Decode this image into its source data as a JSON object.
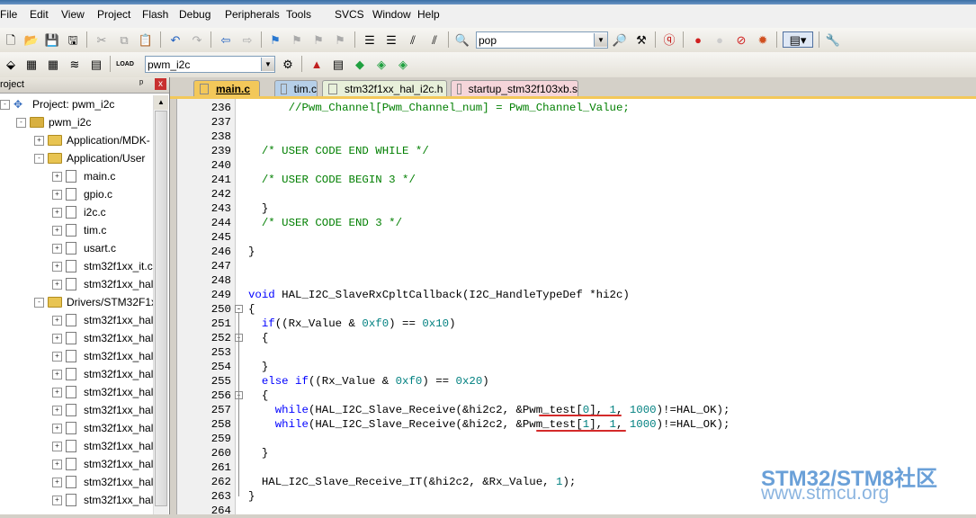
{
  "menu": [
    "File",
    "Edit",
    "View",
    "Project",
    "Flash",
    "Debug",
    "Peripherals",
    "Tools",
    "SVCS",
    "Window",
    "Help"
  ],
  "toolbar1": {
    "find_combo_value": "pop"
  },
  "toolbar2": {
    "target_combo_value": "pwm_i2c"
  },
  "project_pane": {
    "title": "roject",
    "pin": "ᵖ",
    "close": "x",
    "tree": [
      {
        "label": "Project: pwm_i2c",
        "level": 0,
        "type": "project",
        "expand": "-"
      },
      {
        "label": "pwm_i2c",
        "level": 1,
        "type": "target",
        "expand": "-"
      },
      {
        "label": "Application/MDK-",
        "level": 2,
        "type": "folder",
        "expand": "+"
      },
      {
        "label": "Application/User",
        "level": 2,
        "type": "folder",
        "expand": "-"
      },
      {
        "label": "main.c",
        "level": 3,
        "type": "file",
        "expand": "+"
      },
      {
        "label": "gpio.c",
        "level": 3,
        "type": "file",
        "expand": "+"
      },
      {
        "label": "i2c.c",
        "level": 3,
        "type": "file",
        "expand": "+"
      },
      {
        "label": "tim.c",
        "level": 3,
        "type": "file",
        "expand": "+"
      },
      {
        "label": "usart.c",
        "level": 3,
        "type": "file",
        "expand": "+"
      },
      {
        "label": "stm32f1xx_it.c",
        "level": 3,
        "type": "file",
        "expand": "+"
      },
      {
        "label": "stm32f1xx_hal",
        "level": 3,
        "type": "file",
        "expand": "+"
      },
      {
        "label": "Drivers/STM32F1x",
        "level": 2,
        "type": "folder",
        "expand": "-"
      },
      {
        "label": "stm32f1xx_hal_",
        "level": 3,
        "type": "file",
        "expand": "+"
      },
      {
        "label": "stm32f1xx_hal_",
        "level": 3,
        "type": "file",
        "expand": "+"
      },
      {
        "label": "stm32f1xx_hal_",
        "level": 3,
        "type": "file",
        "expand": "+"
      },
      {
        "label": "stm32f1xx_hal_",
        "level": 3,
        "type": "file",
        "expand": "+"
      },
      {
        "label": "stm32f1xx_hal_",
        "level": 3,
        "type": "file",
        "expand": "+"
      },
      {
        "label": "stm32f1xx_hal_",
        "level": 3,
        "type": "file",
        "expand": "+"
      },
      {
        "label": "stm32f1xx_hal_",
        "level": 3,
        "type": "file",
        "expand": "+"
      },
      {
        "label": "stm32f1xx_hal_",
        "level": 3,
        "type": "file",
        "expand": "+"
      },
      {
        "label": "stm32f1xx_hal_",
        "level": 3,
        "type": "file",
        "expand": "+"
      },
      {
        "label": "stm32f1xx_hal_",
        "level": 3,
        "type": "file",
        "expand": "+"
      },
      {
        "label": "stm32f1xx_hal_",
        "level": 3,
        "type": "file",
        "expand": "+"
      }
    ]
  },
  "tabs": [
    {
      "label": "main.c",
      "style": "active"
    },
    {
      "label": "tim.c",
      "style": "tim"
    },
    {
      "label": "stm32f1xx_hal_i2c.h",
      "style": "h"
    },
    {
      "label": "startup_stm32f103xb.s",
      "style": "s"
    }
  ],
  "code_lines": [
    {
      "n": "236",
      "fold": "",
      "segs": [
        [
          "cmt",
          "      //Pwm_Channel[Pwm_Channel_num] = Pwm_Channel_Value;"
        ]
      ]
    },
    {
      "n": "237",
      "fold": "",
      "segs": []
    },
    {
      "n": "238",
      "fold": "",
      "segs": []
    },
    {
      "n": "239",
      "fold": "",
      "segs": [
        [
          "txt",
          "  "
        ],
        [
          "cmt",
          "/* USER CODE END WHILE */"
        ]
      ]
    },
    {
      "n": "240",
      "fold": "",
      "segs": []
    },
    {
      "n": "241",
      "fold": "",
      "segs": [
        [
          "txt",
          "  "
        ],
        [
          "cmt",
          "/* USER CODE BEGIN 3 */"
        ]
      ]
    },
    {
      "n": "242",
      "fold": "",
      "segs": []
    },
    {
      "n": "243",
      "fold": "",
      "segs": [
        [
          "txt",
          "  }"
        ]
      ]
    },
    {
      "n": "244",
      "fold": "",
      "segs": [
        [
          "txt",
          "  "
        ],
        [
          "cmt",
          "/* USER CODE END 3 */"
        ]
      ]
    },
    {
      "n": "245",
      "fold": "",
      "segs": []
    },
    {
      "n": "246",
      "fold": "",
      "segs": [
        [
          "txt",
          "}"
        ]
      ]
    },
    {
      "n": "247",
      "fold": "",
      "segs": []
    },
    {
      "n": "248",
      "fold": "",
      "segs": []
    },
    {
      "n": "249",
      "fold": "",
      "segs": [
        [
          "kw",
          "void"
        ],
        [
          "txt",
          " HAL_I2C_SlaveRxCpltCallback(I2C_HandleTypeDef *hi2c)"
        ]
      ]
    },
    {
      "n": "250",
      "fold": "-",
      "segs": [
        [
          "txt",
          "{"
        ]
      ]
    },
    {
      "n": "251",
      "fold": "",
      "segs": [
        [
          "txt",
          "  "
        ],
        [
          "kw",
          "if"
        ],
        [
          "txt",
          "((Rx_Value & "
        ],
        [
          "num",
          "0xf0"
        ],
        [
          "txt",
          ") == "
        ],
        [
          "num",
          "0x10"
        ],
        [
          "txt",
          ")"
        ]
      ]
    },
    {
      "n": "252",
      "fold": "-",
      "segs": [
        [
          "txt",
          "  {"
        ]
      ]
    },
    {
      "n": "253",
      "fold": "",
      "segs": []
    },
    {
      "n": "254",
      "fold": "",
      "segs": [
        [
          "txt",
          "  }"
        ]
      ]
    },
    {
      "n": "255",
      "fold": "",
      "segs": [
        [
          "txt",
          "  "
        ],
        [
          "kw",
          "else if"
        ],
        [
          "txt",
          "((Rx_Value & "
        ],
        [
          "num",
          "0xf0"
        ],
        [
          "txt",
          ") == "
        ],
        [
          "num",
          "0x20"
        ],
        [
          "txt",
          ")"
        ]
      ]
    },
    {
      "n": "256",
      "fold": "-",
      "segs": [
        [
          "txt",
          "  {"
        ]
      ]
    },
    {
      "n": "257",
      "fold": "",
      "segs": [
        [
          "txt",
          "    "
        ],
        [
          "kw",
          "while"
        ],
        [
          "txt",
          "(HAL_I2C_Slave_Receive(&hi2c2, &Pwm_test["
        ],
        [
          "num",
          "0"
        ],
        [
          "txt",
          "], "
        ],
        [
          "num",
          "1"
        ],
        [
          "txt",
          ", "
        ],
        [
          "num",
          "1000"
        ],
        [
          "txt",
          ")!=HAL_OK);"
        ]
      ]
    },
    {
      "n": "258",
      "fold": "",
      "segs": [
        [
          "txt",
          "    "
        ],
        [
          "kw",
          "while"
        ],
        [
          "txt",
          "(HAL_I2C_Slave_Receive(&hi2c2, &Pwm_test["
        ],
        [
          "num",
          "1"
        ],
        [
          "txt",
          "], "
        ],
        [
          "num",
          "1"
        ],
        [
          "txt",
          ", "
        ],
        [
          "num",
          "1000"
        ],
        [
          "txt",
          ")!=HAL_OK);"
        ]
      ]
    },
    {
      "n": "259",
      "fold": "",
      "segs": []
    },
    {
      "n": "260",
      "fold": "",
      "segs": [
        [
          "txt",
          "  }"
        ]
      ]
    },
    {
      "n": "261",
      "fold": "",
      "segs": []
    },
    {
      "n": "262",
      "fold": "",
      "segs": [
        [
          "txt",
          "  HAL_I2C_Slave_Receive_IT(&hi2c2, &Rx_Value, "
        ],
        [
          "num",
          "1"
        ],
        [
          "txt",
          ");"
        ]
      ]
    },
    {
      "n": "263",
      "fold": "",
      "segs": [
        [
          "txt",
          "}"
        ]
      ]
    },
    {
      "n": "264",
      "fold": "",
      "segs": []
    }
  ],
  "watermark": {
    "line1": "STM32/STM8社区",
    "line2": "www.stmcu.org"
  },
  "colors": {
    "comment": "#007f00",
    "keyword": "#0000ff",
    "number": "#008080",
    "active_tab": "#f3c85a",
    "underline": "#d42a2a"
  }
}
